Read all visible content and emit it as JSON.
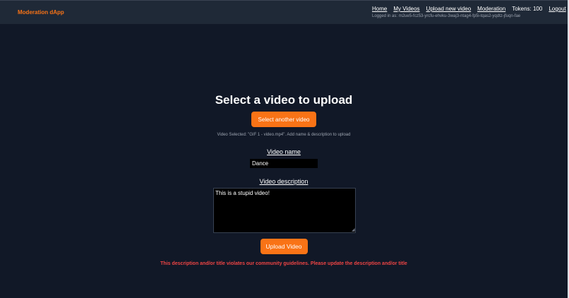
{
  "header": {
    "brand": "Moderation dApp",
    "nav": {
      "home": "Home",
      "my_videos": "My Videos",
      "upload": "Upload new video",
      "moderation": "Moderation",
      "tokens": "Tokens: 100",
      "logout": "Logout"
    },
    "logged_in": "Logged in as: m2ue5-fcz53-yrcfu-ehvku-3waj3-ntag4-fp5i-tqas2-yqdtz-jfuqn-fae"
  },
  "upload": {
    "title": "Select a video to upload",
    "select_button": "Select another video",
    "selected_info": "Video Selected: \"GIF 1 - video.mp4\". Add name & description to upload",
    "name_label": "Video name",
    "name_value": "Dance",
    "description_label": "Video description",
    "description_value": "This is a stupid video!",
    "upload_button": "Upload Video",
    "error": "This description and/or title violates our community guidelines. Please update the description and/or title"
  },
  "colors": {
    "accent": "#f97316",
    "header_bg": "#1f2937",
    "page_bg": "#111827",
    "error": "#ef4444"
  }
}
